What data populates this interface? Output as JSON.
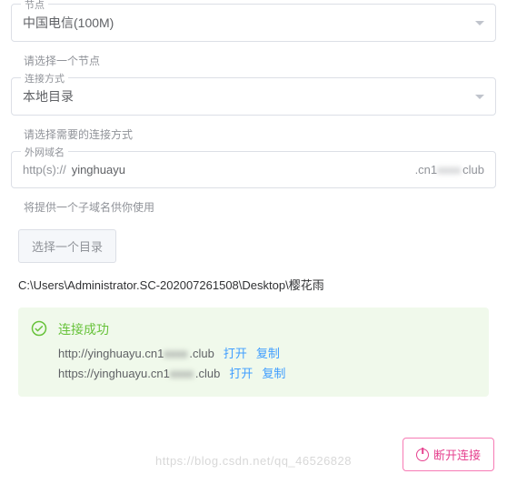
{
  "node": {
    "legend": "节点",
    "value": "中国电信(100M)",
    "hint": "请选择一个节点"
  },
  "conn": {
    "legend": "连接方式",
    "value": "本地目录",
    "hint": "请选择需要的连接方式"
  },
  "domain": {
    "legend": "外网域名",
    "prefix": "http(s)://",
    "value": "yinghuayu",
    "suffix_a": ".cn1",
    "suffix_blur": "xxxx",
    "suffix_b": "club",
    "hint": "将提供一个子域名供你使用"
  },
  "dir": {
    "button": "选择一个目录",
    "path": "C:\\Users\\Administrator.SC-202007261508\\Desktop\\樱花雨"
  },
  "alert": {
    "title": "连接成功",
    "lines": [
      {
        "url_a": "http://yinghuayu.cn1",
        "url_blur": "xxxx",
        "url_b": ".club"
      },
      {
        "url_a": "https://yinghuayu.cn1",
        "url_blur": "xxxx",
        "url_b": ".club"
      }
    ],
    "open": "打开",
    "copy": "复制"
  },
  "disconnect": "断开连接",
  "watermark": "https://blog.csdn.net/qq_46526828"
}
